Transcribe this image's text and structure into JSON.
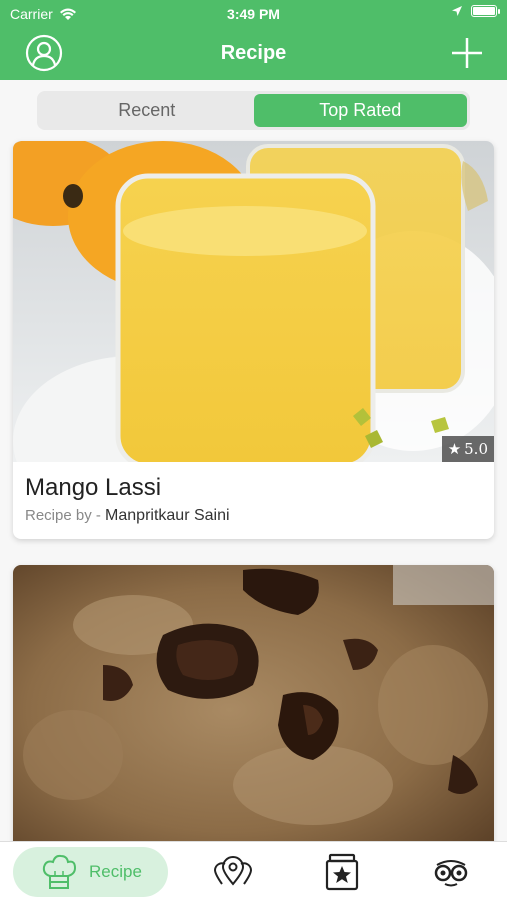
{
  "status_bar": {
    "carrier": "Carrier",
    "time": "3:49 PM"
  },
  "nav": {
    "title": "Recipe",
    "left_icon": "profile-icon",
    "right_icon": "add-icon"
  },
  "segments": [
    {
      "label": "Recent",
      "active": false
    },
    {
      "label": "Top Rated",
      "active": true
    }
  ],
  "recipes": [
    {
      "name": "Mango Lassi",
      "byline_prefix": "Recipe by - ",
      "author": "Manpritkaur Saini",
      "rating": "5.0",
      "image": "mango-lassi-photo"
    },
    {
      "name": "",
      "image": "chocolate-chip-cookie-photo"
    }
  ],
  "tab_bar": {
    "items": [
      {
        "label": "Recipe",
        "icon": "chef-hat-icon",
        "active": true
      },
      {
        "icon": "map-pins-icon"
      },
      {
        "icon": "starred-jar-icon"
      },
      {
        "icon": "glasses-face-icon"
      }
    ]
  },
  "colors": {
    "accent": "#4fbe69",
    "accent_light": "#d8f1de",
    "segment_bg": "#e9e9e9"
  }
}
